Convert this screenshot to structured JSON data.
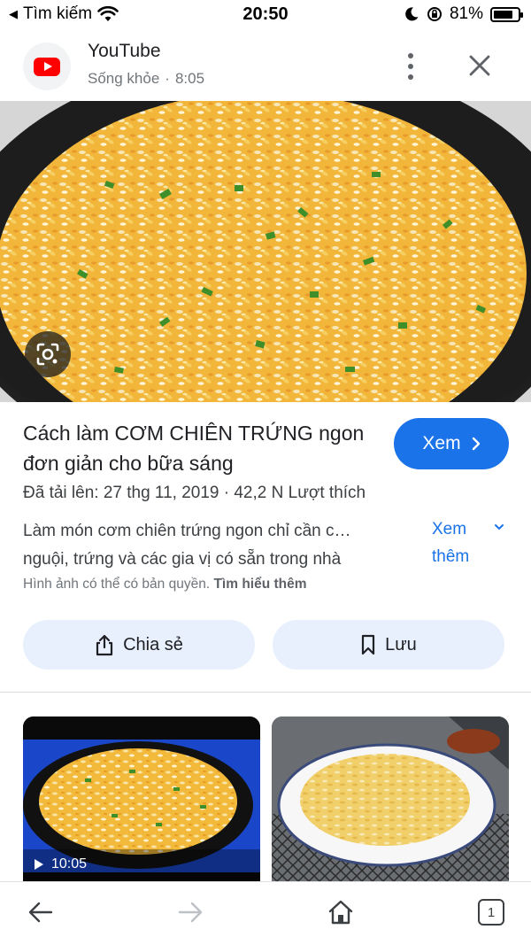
{
  "status_bar": {
    "back_label": "Tìm kiếm",
    "time": "20:50",
    "battery": "81%",
    "battery_level": 0.81
  },
  "header": {
    "site": "YouTube",
    "channel": "Sống khỏe",
    "duration": "8:05",
    "separator": "·"
  },
  "result": {
    "title": "Cách làm CƠM CHIÊN TRỨNG ngon đơn giản cho bữa sáng",
    "view_button": "Xem",
    "meta": "Đã tải lên: 27 thg 11, 2019 · 42,2 N Lượt thích",
    "description_line1": "Làm món cơm chiên trứng ngon chỉ cần c…",
    "description_line2": "nguội, trứng và các gia vị có sẵn trong nhà",
    "see_more": "Xem thêm",
    "copyright": "Hình ảnh có thể có bản quyền.",
    "learn_more": "Tìm hiểu thêm"
  },
  "actions": {
    "share": "Chia sẻ",
    "save": "Lưu"
  },
  "related": {
    "first_duration": "10:05"
  },
  "bottom_nav": {
    "tab_count": "1"
  },
  "colors": {
    "accent": "#1a73e8",
    "pill_bg": "#e8f0fe",
    "youtube_red": "#ff0000"
  },
  "icons": [
    "back-triangle-icon",
    "wifi-icon",
    "moon-icon",
    "rotation-lock-icon",
    "battery-icon",
    "youtube-logo-icon",
    "more-vert-icon",
    "close-icon",
    "lens-icon",
    "chevron-right-icon",
    "chevron-down-icon",
    "share-icon",
    "bookmark-icon",
    "play-icon",
    "back-arrow-icon",
    "forward-arrow-icon",
    "home-icon",
    "tabs-icon"
  ]
}
